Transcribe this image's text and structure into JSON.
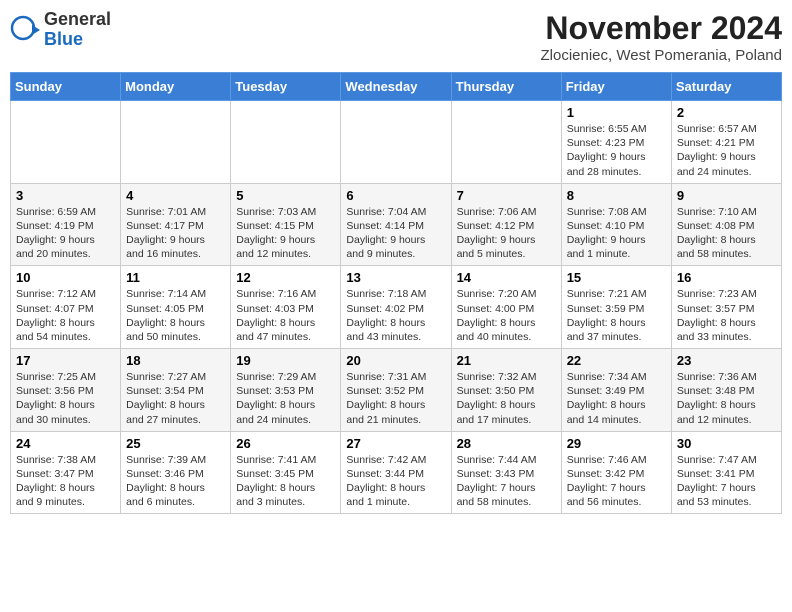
{
  "header": {
    "logo_general": "General",
    "logo_blue": "Blue",
    "month_title": "November 2024",
    "location": "Zlocieniec, West Pomerania, Poland"
  },
  "days_of_week": [
    "Sunday",
    "Monday",
    "Tuesday",
    "Wednesday",
    "Thursday",
    "Friday",
    "Saturday"
  ],
  "weeks": [
    [
      {
        "day": "",
        "info": ""
      },
      {
        "day": "",
        "info": ""
      },
      {
        "day": "",
        "info": ""
      },
      {
        "day": "",
        "info": ""
      },
      {
        "day": "",
        "info": ""
      },
      {
        "day": "1",
        "info": "Sunrise: 6:55 AM\nSunset: 4:23 PM\nDaylight: 9 hours and 28 minutes."
      },
      {
        "day": "2",
        "info": "Sunrise: 6:57 AM\nSunset: 4:21 PM\nDaylight: 9 hours and 24 minutes."
      }
    ],
    [
      {
        "day": "3",
        "info": "Sunrise: 6:59 AM\nSunset: 4:19 PM\nDaylight: 9 hours and 20 minutes."
      },
      {
        "day": "4",
        "info": "Sunrise: 7:01 AM\nSunset: 4:17 PM\nDaylight: 9 hours and 16 minutes."
      },
      {
        "day": "5",
        "info": "Sunrise: 7:03 AM\nSunset: 4:15 PM\nDaylight: 9 hours and 12 minutes."
      },
      {
        "day": "6",
        "info": "Sunrise: 7:04 AM\nSunset: 4:14 PM\nDaylight: 9 hours and 9 minutes."
      },
      {
        "day": "7",
        "info": "Sunrise: 7:06 AM\nSunset: 4:12 PM\nDaylight: 9 hours and 5 minutes."
      },
      {
        "day": "8",
        "info": "Sunrise: 7:08 AM\nSunset: 4:10 PM\nDaylight: 9 hours and 1 minute."
      },
      {
        "day": "9",
        "info": "Sunrise: 7:10 AM\nSunset: 4:08 PM\nDaylight: 8 hours and 58 minutes."
      }
    ],
    [
      {
        "day": "10",
        "info": "Sunrise: 7:12 AM\nSunset: 4:07 PM\nDaylight: 8 hours and 54 minutes."
      },
      {
        "day": "11",
        "info": "Sunrise: 7:14 AM\nSunset: 4:05 PM\nDaylight: 8 hours and 50 minutes."
      },
      {
        "day": "12",
        "info": "Sunrise: 7:16 AM\nSunset: 4:03 PM\nDaylight: 8 hours and 47 minutes."
      },
      {
        "day": "13",
        "info": "Sunrise: 7:18 AM\nSunset: 4:02 PM\nDaylight: 8 hours and 43 minutes."
      },
      {
        "day": "14",
        "info": "Sunrise: 7:20 AM\nSunset: 4:00 PM\nDaylight: 8 hours and 40 minutes."
      },
      {
        "day": "15",
        "info": "Sunrise: 7:21 AM\nSunset: 3:59 PM\nDaylight: 8 hours and 37 minutes."
      },
      {
        "day": "16",
        "info": "Sunrise: 7:23 AM\nSunset: 3:57 PM\nDaylight: 8 hours and 33 minutes."
      }
    ],
    [
      {
        "day": "17",
        "info": "Sunrise: 7:25 AM\nSunset: 3:56 PM\nDaylight: 8 hours and 30 minutes."
      },
      {
        "day": "18",
        "info": "Sunrise: 7:27 AM\nSunset: 3:54 PM\nDaylight: 8 hours and 27 minutes."
      },
      {
        "day": "19",
        "info": "Sunrise: 7:29 AM\nSunset: 3:53 PM\nDaylight: 8 hours and 24 minutes."
      },
      {
        "day": "20",
        "info": "Sunrise: 7:31 AM\nSunset: 3:52 PM\nDaylight: 8 hours and 21 minutes."
      },
      {
        "day": "21",
        "info": "Sunrise: 7:32 AM\nSunset: 3:50 PM\nDaylight: 8 hours and 17 minutes."
      },
      {
        "day": "22",
        "info": "Sunrise: 7:34 AM\nSunset: 3:49 PM\nDaylight: 8 hours and 14 minutes."
      },
      {
        "day": "23",
        "info": "Sunrise: 7:36 AM\nSunset: 3:48 PM\nDaylight: 8 hours and 12 minutes."
      }
    ],
    [
      {
        "day": "24",
        "info": "Sunrise: 7:38 AM\nSunset: 3:47 PM\nDaylight: 8 hours and 9 minutes."
      },
      {
        "day": "25",
        "info": "Sunrise: 7:39 AM\nSunset: 3:46 PM\nDaylight: 8 hours and 6 minutes."
      },
      {
        "day": "26",
        "info": "Sunrise: 7:41 AM\nSunset: 3:45 PM\nDaylight: 8 hours and 3 minutes."
      },
      {
        "day": "27",
        "info": "Sunrise: 7:42 AM\nSunset: 3:44 PM\nDaylight: 8 hours and 1 minute."
      },
      {
        "day": "28",
        "info": "Sunrise: 7:44 AM\nSunset: 3:43 PM\nDaylight: 7 hours and 58 minutes."
      },
      {
        "day": "29",
        "info": "Sunrise: 7:46 AM\nSunset: 3:42 PM\nDaylight: 7 hours and 56 minutes."
      },
      {
        "day": "30",
        "info": "Sunrise: 7:47 AM\nSunset: 3:41 PM\nDaylight: 7 hours and 53 minutes."
      }
    ]
  ]
}
